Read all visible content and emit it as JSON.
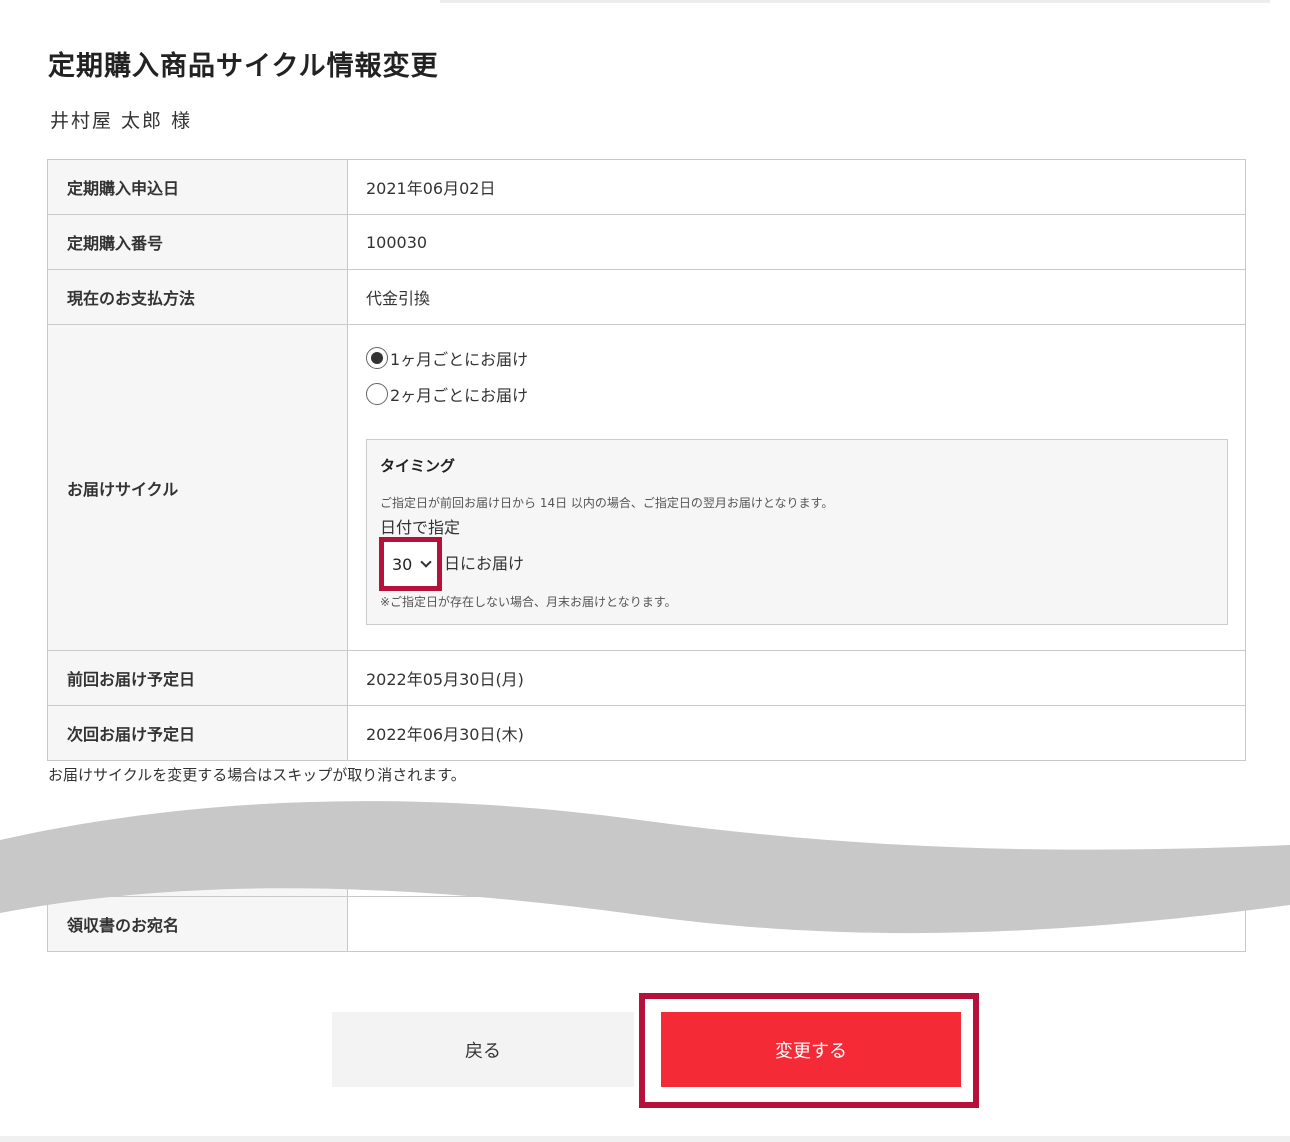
{
  "page": {
    "title": "定期購入商品サイクル情報変更",
    "customer_name": "井村屋 太郎 様"
  },
  "table": {
    "rows": [
      {
        "label": "定期購入申込日",
        "value": "2021年06月02日"
      },
      {
        "label": "定期購入番号",
        "value": "100030"
      },
      {
        "label": "現在のお支払方法",
        "value": "代金引換"
      }
    ],
    "cycle": {
      "label": "お届けサイクル",
      "options": [
        {
          "label": "1ヶ月ごとにお届け",
          "selected": true
        },
        {
          "label": "2ヶ月ごとにお届け",
          "selected": false
        }
      ],
      "timing": {
        "title": "タイミング",
        "note": "ご指定日が前回お届け日から 14日 以内の場合、ご指定日の翌月お届けとなります。",
        "date_label": "日付で指定",
        "day_value": "30",
        "suffix": "日にお届け",
        "nonexist_note": "※ご指定日が存在しない場合、月末お届けとなります。"
      }
    },
    "previous_delivery": {
      "label": "前回お届け予定日",
      "value": "2022年05月30日(月)"
    },
    "next_delivery": {
      "label": "次回お届け予定日",
      "value": "2022年06月30日(木)"
    }
  },
  "skip_note": "お届けサイクルを変更する場合はスキップが取り消されます。",
  "receipt": {
    "label": "領収書のお宛名"
  },
  "buttons": {
    "back": "戻る",
    "submit": "変更する"
  },
  "colors": {
    "accent": "#f42a37",
    "highlight": "#b5113a",
    "header_bg": "#f6f6f6",
    "border": "#c9c9c9",
    "wave": "#c8c8c8"
  }
}
